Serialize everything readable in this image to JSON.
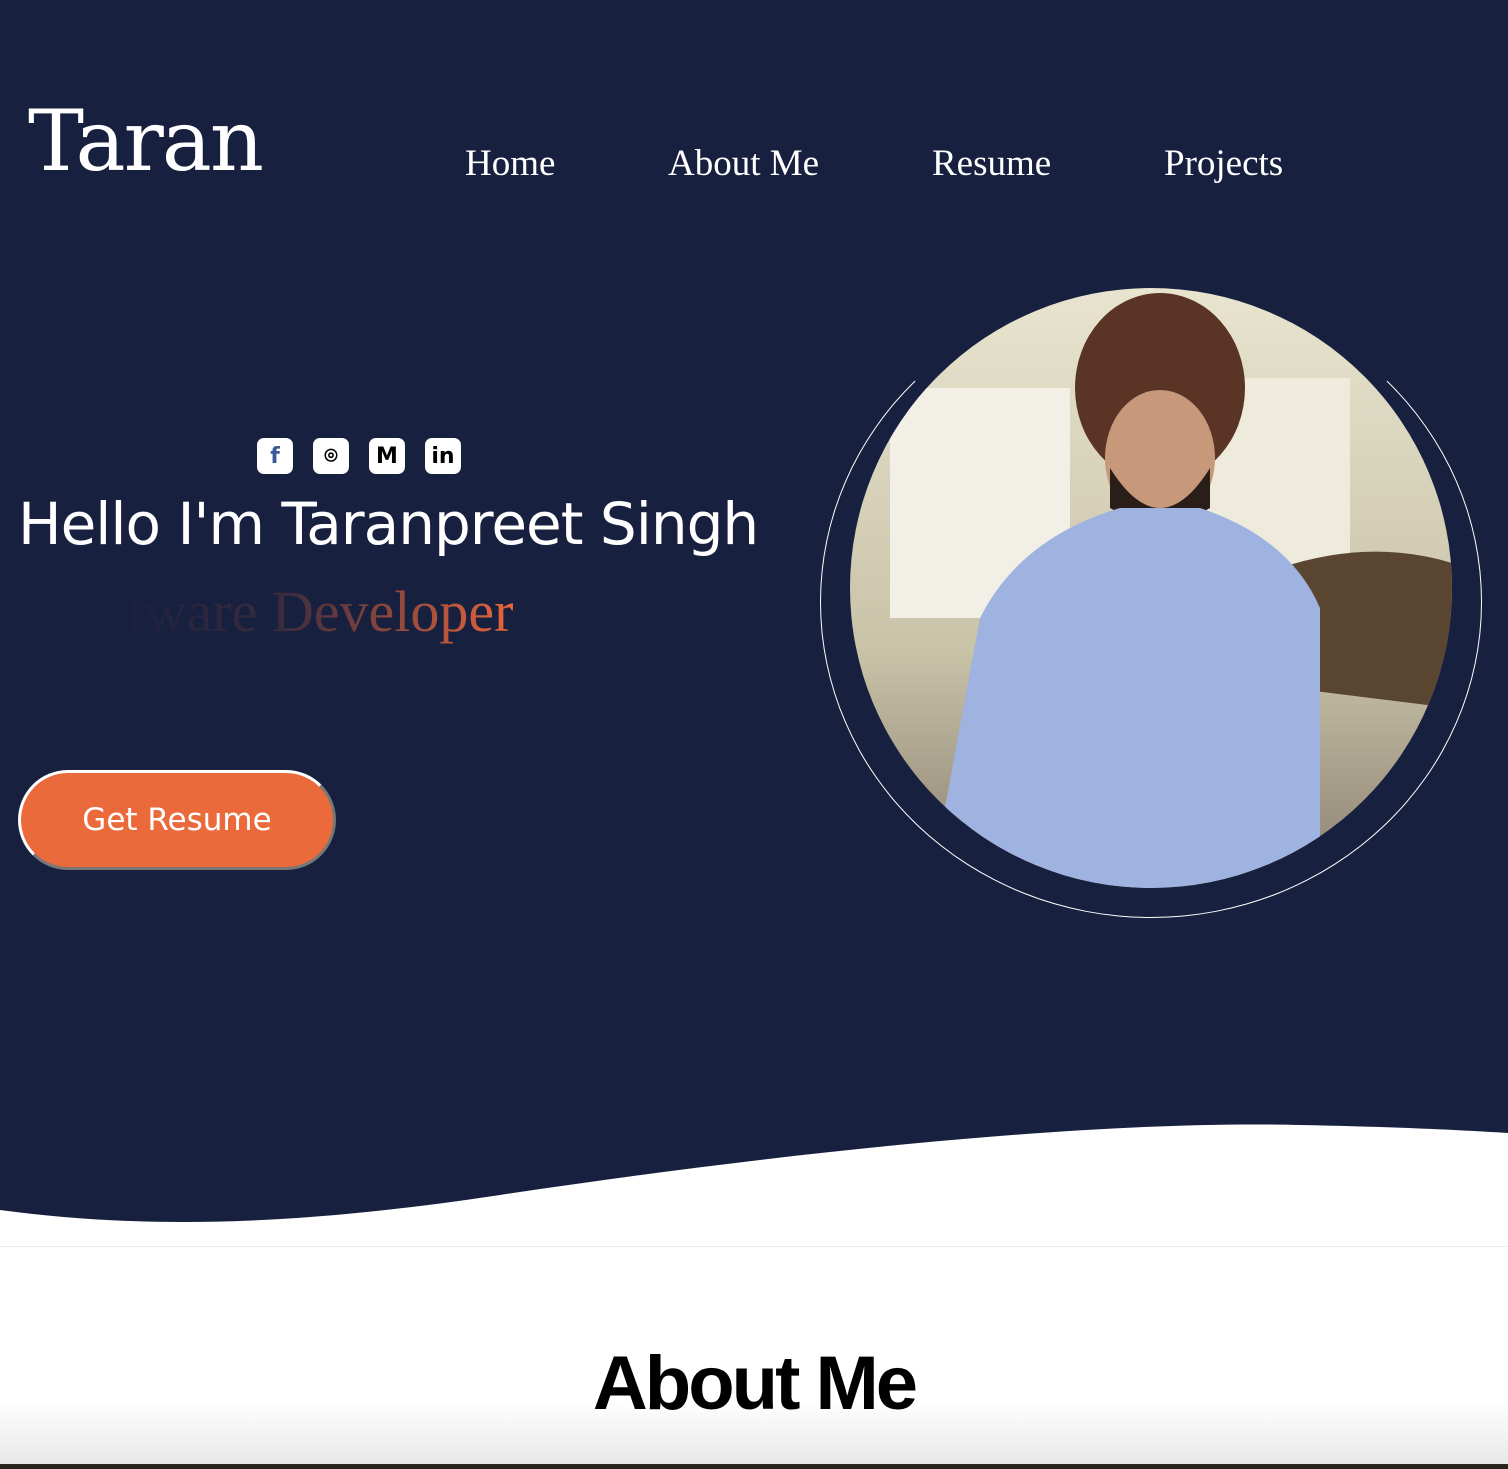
{
  "header": {
    "logo": "Taran",
    "nav": [
      "Home",
      "About Me",
      "Resume",
      "Projects"
    ]
  },
  "hero": {
    "socials": [
      {
        "icon": "facebook-icon",
        "glyph": "f"
      },
      {
        "icon": "github-icon",
        "glyph": "⌾"
      },
      {
        "icon": "gmail-icon",
        "glyph": "M"
      },
      {
        "icon": "linkedin-icon",
        "glyph": "in"
      }
    ],
    "greeting": "Hello I'm Taranpreet Singh",
    "role": "Software Developer",
    "cta": "Get Resume"
  },
  "about": {
    "title": "About Me"
  },
  "colors": {
    "navy": "#18203f",
    "accent": "#eb6a3c"
  }
}
